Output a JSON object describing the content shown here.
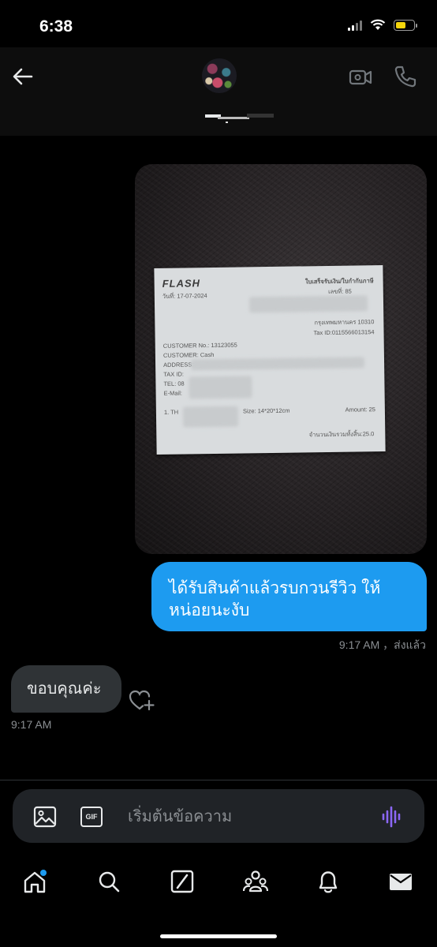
{
  "status_bar": {
    "time": "6:38",
    "battery_color": "#f5d50b"
  },
  "header": {
    "back_icon": "arrow-left-icon",
    "avatar_icon": "avatar",
    "video_icon": "video-call-icon",
    "phone_icon": "phone-icon"
  },
  "messages": {
    "outgoing_text": "ได้รับสินค้าแล้วรบกวนรีวิว ให้หน่อยนะงับ",
    "outgoing_meta": "9:17 AM ，ส่งแล้ว",
    "incoming_text": "ขอบคุณค่ะ",
    "incoming_meta": "9:17 AM"
  },
  "receipt": {
    "logo": "FLASH",
    "date": "วันที่: 17-07-2024",
    "title": "ใบเสร็จรับเงิน/ใบกำกับภาษี",
    "number": "เลขที่: 85",
    "city": "กรุงเทพมหานคร 10310",
    "tax_id": "Tax ID:0115566013154",
    "customer_no": "CUSTOMER No.: 13123055",
    "customer": "CUSTOMER: Cash",
    "address": "ADDRESS:",
    "tax_id_label": "TAX ID:",
    "tel": "TEL: 08",
    "email": "E-Mail:",
    "item": "1. TH",
    "size": "Size: 14*20*12cm",
    "amount": "Amount: 25",
    "total": "จำนวนเงินรวมทั้งสิ้น:25.0"
  },
  "composer": {
    "placeholder": "เริ่มต้นข้อความ",
    "gif_label": "GIF",
    "accent": "#8b67f5"
  },
  "tabbar": {
    "items": [
      "home-icon",
      "search-icon",
      "grok-icon",
      "communities-icon",
      "notifications-icon",
      "messages-icon"
    ],
    "badge_color": "#1d9bf0"
  }
}
